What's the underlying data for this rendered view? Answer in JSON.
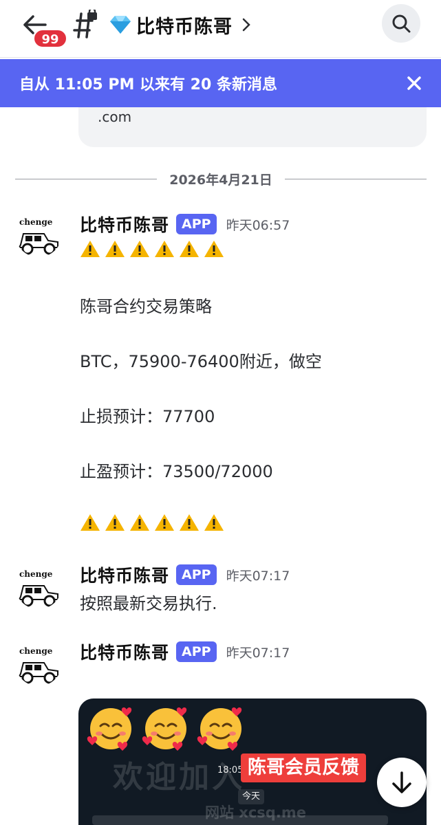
{
  "header": {
    "unread_count": "99",
    "channel_name": "比特币陈哥"
  },
  "banner": {
    "text": "自从 11:05 PM 以来有 20 条新消息"
  },
  "previous_embed": {
    "text": ".com"
  },
  "date_divider": "2026年4月21日",
  "messages": [
    {
      "author": "比特币陈哥",
      "tag": "APP",
      "time": "昨天06:57",
      "avatar_label": "chenge",
      "lines": [
        "陈哥合约交易策略",
        "BTC，75900-76400附近，做空",
        "止损预计：77700",
        "止盈预计：73500/72000"
      ]
    },
    {
      "author": "比特币陈哥",
      "tag": "APP",
      "time": "昨天07:17",
      "avatar_label": "chenge",
      "lines": [
        "按照最新交易执行."
      ]
    },
    {
      "author": "比特币陈哥",
      "tag": "APP",
      "time": "昨天07:17",
      "avatar_label": "chenge"
    }
  ],
  "image_embed": {
    "watermark": "欢迎加入",
    "time": "18:05",
    "label": "陈哥会员反馈",
    "today": "今天",
    "site": "网站 xcsq.me"
  },
  "icons": {
    "back": "arrow-left-icon",
    "thread": "hashtag-lock-icon",
    "gem": "gem-icon",
    "search": "search-icon",
    "close": "close-icon",
    "warning": "warning-icon",
    "scroll": "arrow-down-icon"
  },
  "colors": {
    "accent": "#5865f2",
    "badge": "#e2313d",
    "feedback": "#ee3e3b"
  }
}
